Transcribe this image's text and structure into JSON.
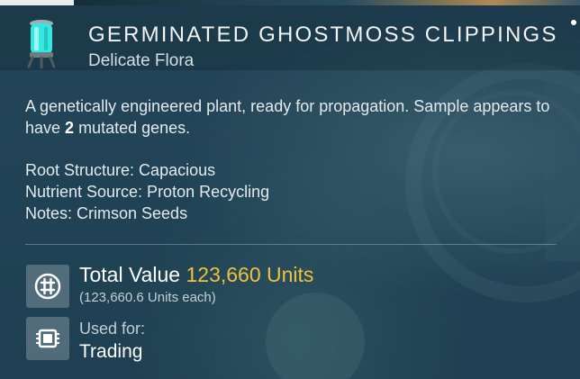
{
  "item": {
    "name": "GERMINATED GHOSTMOSS CLIPPINGS",
    "category": "Delicate Flora",
    "icon": "glowing-capsule-icon"
  },
  "description": {
    "text_before": "A genetically engineered plant, ready for propagation. Sample appears to have ",
    "mutation_count": "2",
    "text_after": " mutated genes."
  },
  "properties": [
    "Root Structure: Capacious",
    "Nutrient Source: Proton Recycling",
    "Notes: Crimson Seeds"
  ],
  "value": {
    "label": "Total Value",
    "amount": "123,660 Units",
    "each": "(123,660.6 Units each)",
    "icon": "units-currency-icon"
  },
  "usage": {
    "label": "Used for:",
    "value": "Trading",
    "icon": "trade-chip-icon"
  },
  "colors": {
    "accent_value": "#f0c23a",
    "panel_bg": "#1f4457",
    "text_primary": "#ffffff",
    "text_secondary": "#c2cfd3"
  }
}
